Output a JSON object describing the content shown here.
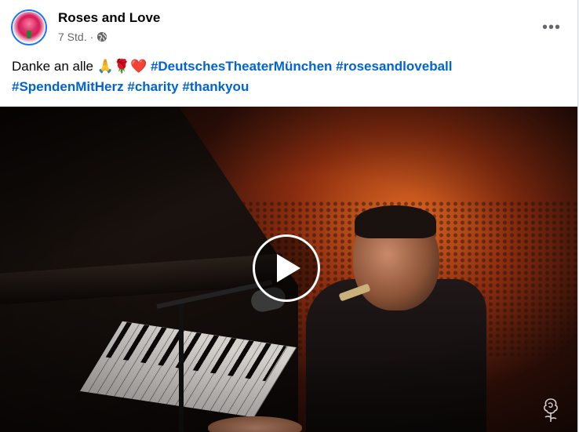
{
  "post": {
    "page_name": "Roses and Love",
    "time": "7 Std.",
    "separator": "·",
    "audience_icon": "globe-icon",
    "more_label": "•••",
    "caption": {
      "text": "Danke an alle",
      "emojis": "🙏🌹❤️",
      "hashtags": [
        "#DeutschesTheaterMünchen",
        "#rosesandloveball",
        "#SpendenMitHerz",
        "#charity",
        "#thankyou"
      ]
    },
    "video": {
      "play_icon": "play-icon",
      "watermark_icon": "rose-outline-icon"
    }
  },
  "colors": {
    "hashtag": "#0064d1",
    "meta_text": "#65676b",
    "avatar_ring": "#1877f2"
  }
}
